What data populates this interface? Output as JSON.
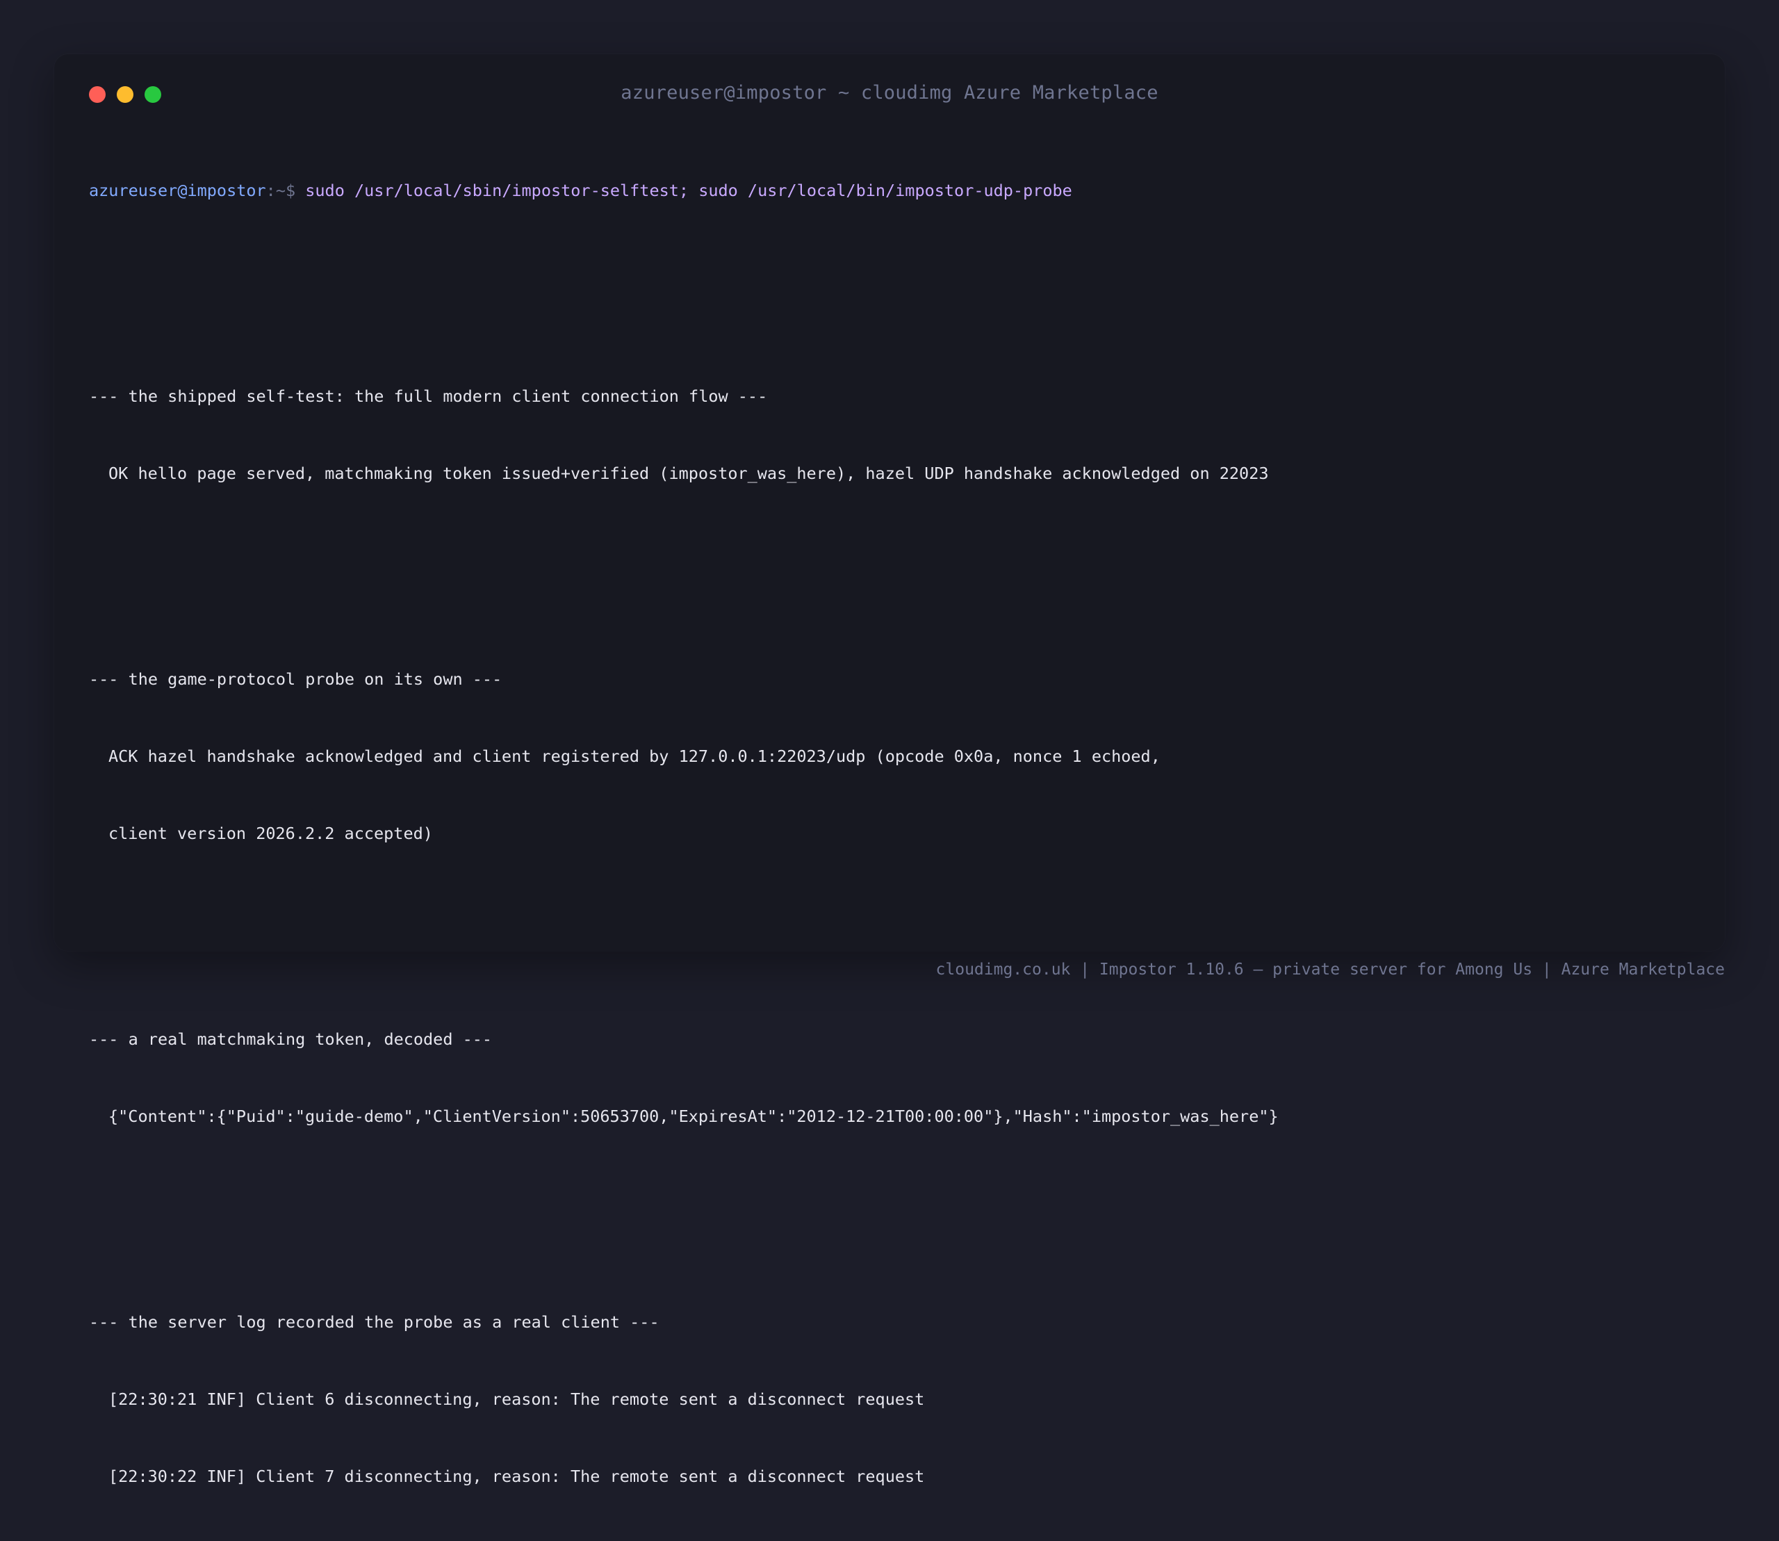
{
  "window": {
    "title": "azureuser@impostor ~ cloudimg Azure Marketplace"
  },
  "terminal": {
    "prompt_user": "azureuser@impostor",
    "prompt_path": ":~$ ",
    "command": "sudo /usr/local/sbin/impostor-selftest; sudo /usr/local/bin/impostor-udp-probe",
    "sections": [
      {
        "header": "--- the shipped self-test: the full modern client connection flow ---",
        "lines": [
          "OK hello page served, matchmaking token issued+verified (impostor_was_here), hazel UDP handshake acknowledged on 22023"
        ]
      },
      {
        "header": "--- the game-protocol probe on its own ---",
        "lines": [
          "ACK hazel handshake acknowledged and client registered by 127.0.0.1:22023/udp (opcode 0x0a, nonce 1 echoed,",
          "client version 2026.2.2 accepted)"
        ]
      },
      {
        "header": "--- a real matchmaking token, decoded ---",
        "lines": [
          "{\"Content\":{\"Puid\":\"guide-demo\",\"ClientVersion\":50653700,\"ExpiresAt\":\"2012-12-21T00:00:00\"},\"Hash\":\"impostor_was_here\"}"
        ]
      },
      {
        "header": "--- the server log recorded the probe as a real client ---",
        "lines": [
          "[22:30:21 INF] Client 6 disconnecting, reason: The remote sent a disconnect request",
          "[22:30:22 INF] Client 7 disconnecting, reason: The remote sent a disconnect request"
        ]
      }
    ]
  },
  "footer": {
    "text": "cloudimg.co.uk | Impostor 1.10.6 — private server for Among Us | Azure Marketplace"
  },
  "colors": {
    "background": "#1c1d29",
    "window": "#171821",
    "prompt_user": "#82aaff",
    "command": "#c9a9ff",
    "text": "#e6e6ee",
    "muted": "#6f7590",
    "close": "#ff5f57",
    "minimize": "#febc2e",
    "maximize": "#28c840"
  }
}
